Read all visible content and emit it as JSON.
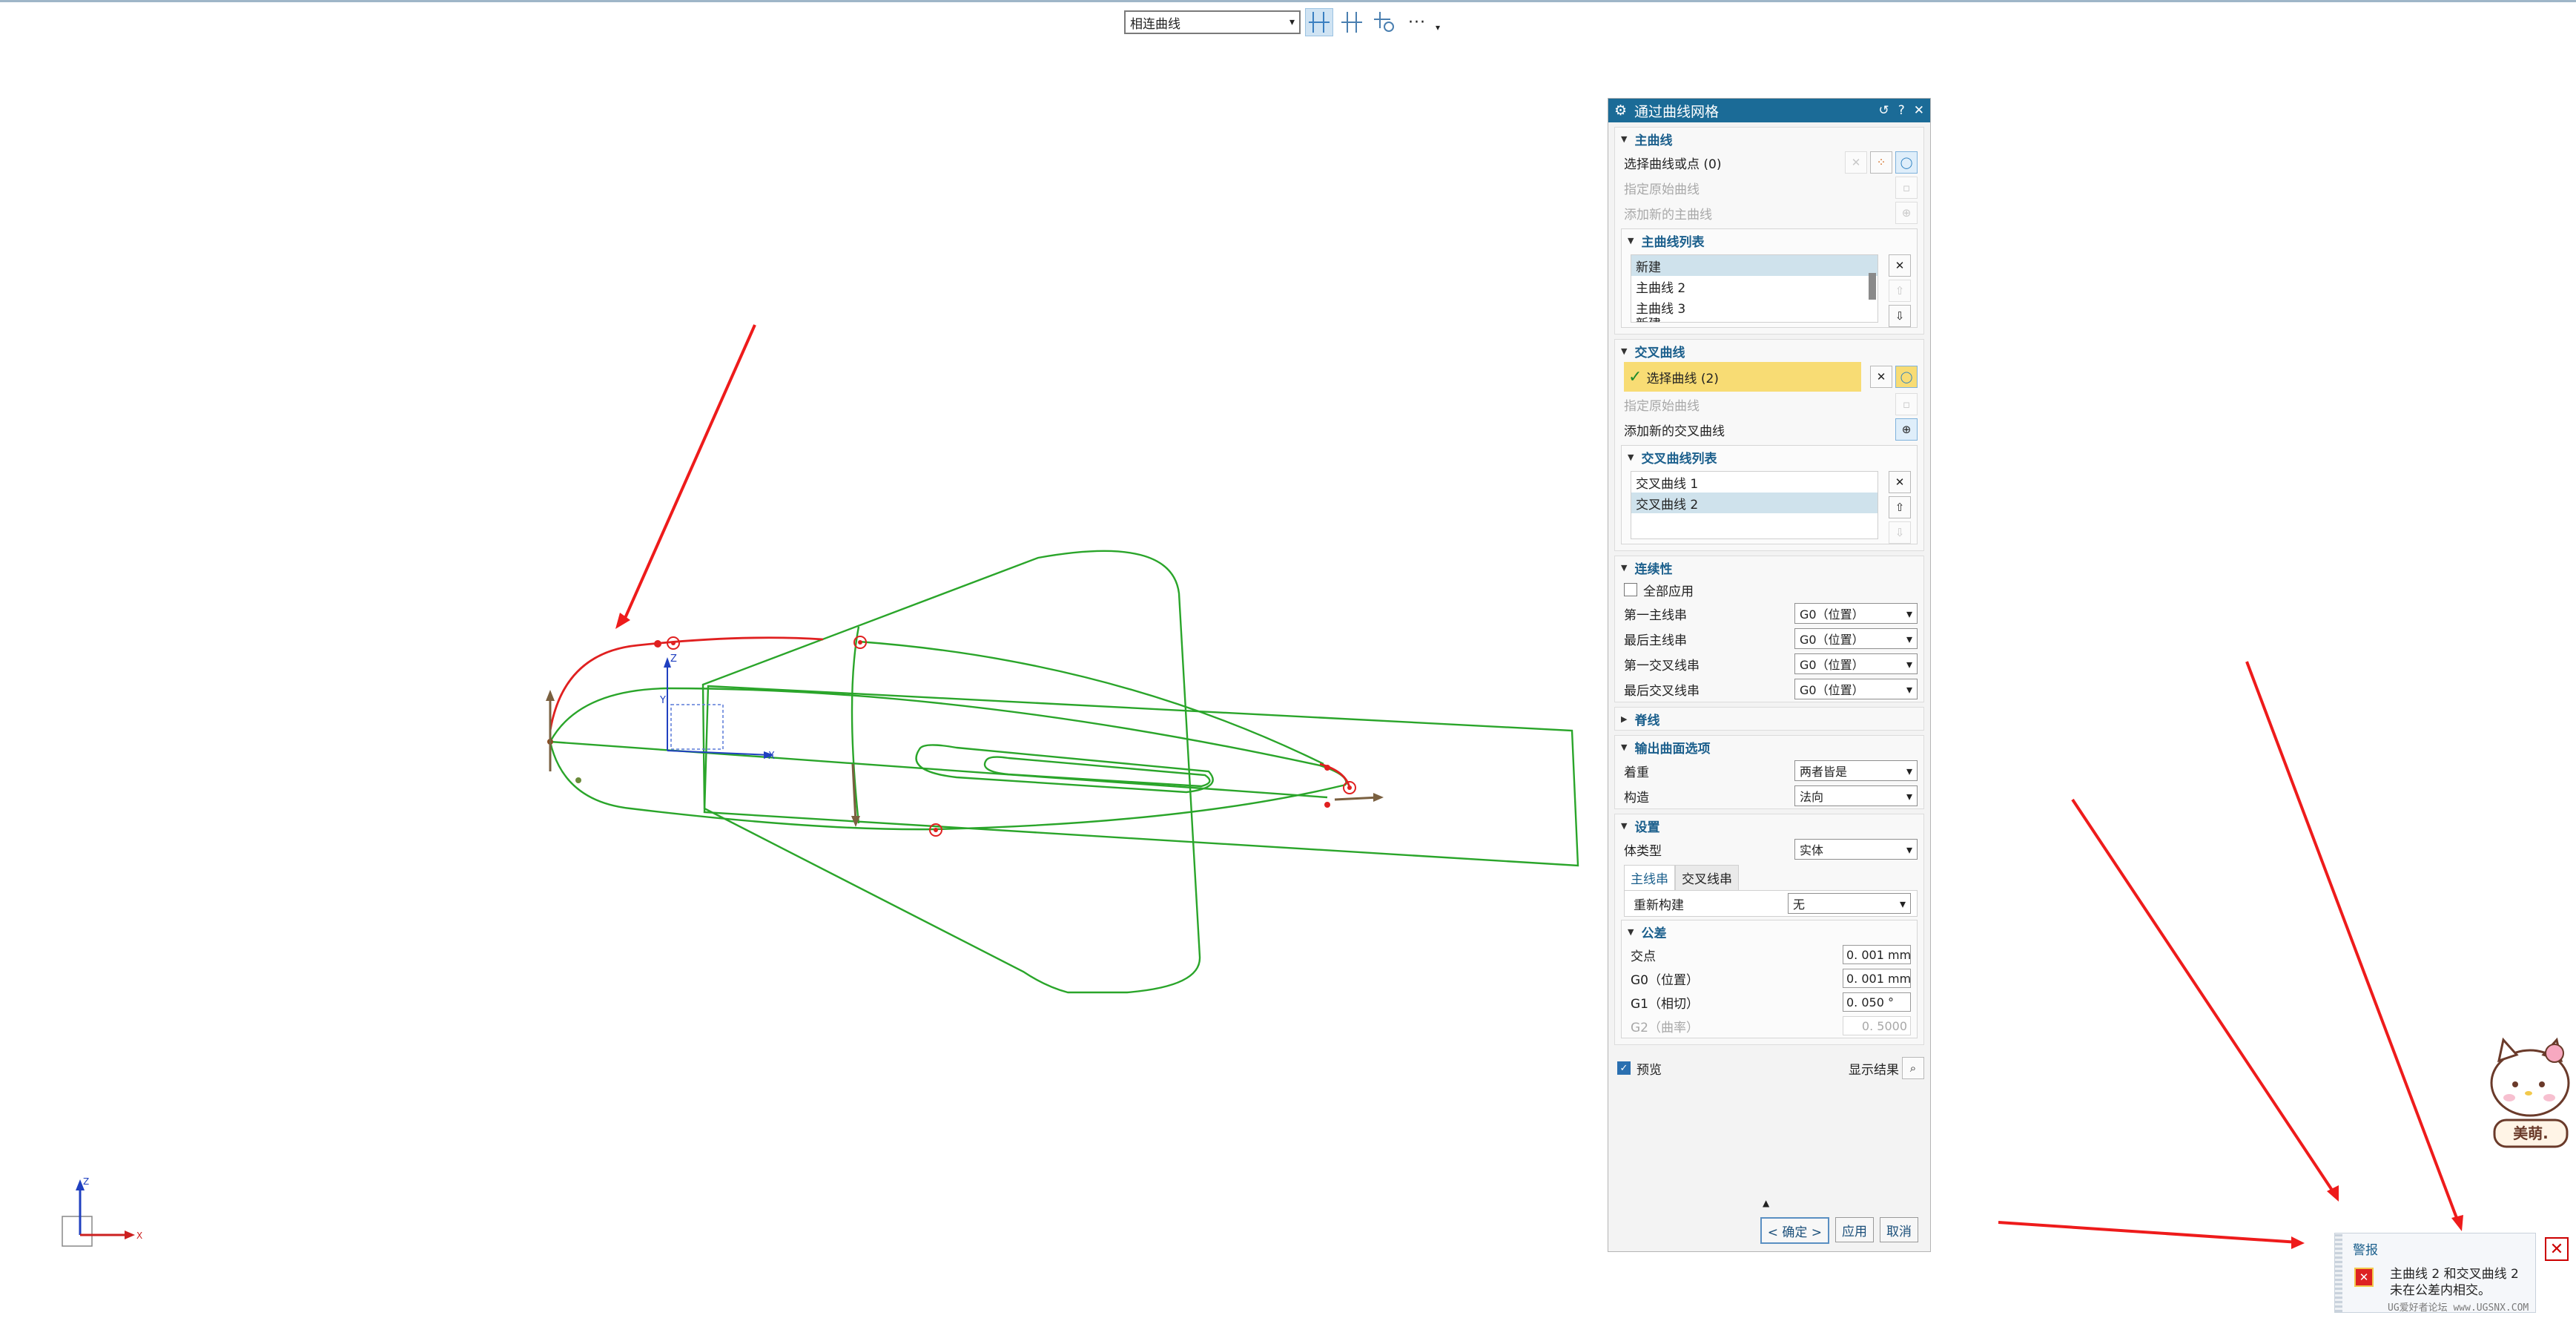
{
  "selection_toolbar": {
    "curve_rule": "相连曲线"
  },
  "dialog": {
    "title": "通过曲线网格",
    "primary": {
      "header": "主曲线",
      "select_label": "选择曲线或点 (0)",
      "specify_origin": "指定原始曲线",
      "add_new": "添加新的主曲线",
      "list_header": "主曲线列表",
      "list": [
        "新建",
        "主曲线 2",
        "主曲线 3",
        "新建"
      ]
    },
    "cross": {
      "header": "交叉曲线",
      "select_label": "选择曲线 (2)",
      "specify_origin": "指定原始曲线",
      "add_new": "添加新的交叉曲线",
      "list_header": "交叉曲线列表",
      "list": [
        "交叉曲线 1",
        "交叉曲线 2"
      ]
    },
    "continuity": {
      "header": "连续性",
      "apply_all": "全部应用",
      "rows": [
        {
          "label": "第一主线串",
          "value": "G0（位置）"
        },
        {
          "label": "最后主线串",
          "value": "G0（位置）"
        },
        {
          "label": "第一交叉线串",
          "value": "G0（位置）"
        },
        {
          "label": "最后交叉线串",
          "value": "G0（位置）"
        }
      ]
    },
    "spine": {
      "header": "脊线"
    },
    "output": {
      "header": "输出曲面选项",
      "emphasis_label": "着重",
      "emphasis_value": "两者皆是",
      "construction_label": "构造",
      "construction_value": "法向"
    },
    "settings": {
      "header": "设置",
      "body_type_label": "体类型",
      "body_type_value": "实体",
      "tab_primary": "主线串",
      "tab_cross": "交叉线串",
      "rebuild_label": "重新构建",
      "rebuild_value": "无",
      "tolerance": {
        "header": "公差",
        "rows": [
          {
            "label": "交点",
            "value": "0. 001 mm"
          },
          {
            "label": "G0（位置）",
            "value": "0. 001 mm"
          },
          {
            "label": "G1（相切）",
            "value": "0. 050 °"
          },
          {
            "label": "G2（曲率）",
            "value": "0. 5000"
          }
        ]
      }
    },
    "preview": {
      "label": "预览",
      "show_result": "显示结果"
    },
    "buttons": {
      "ok": "< 确定 >",
      "apply": "应用",
      "cancel": "取消"
    }
  },
  "alert": {
    "title": "警报",
    "message_line1": "主曲线 2 和交叉曲线 2",
    "message_line2": "未在公差内相交。"
  },
  "mascot": {
    "label": "美萌."
  },
  "watermark": "UG爱好者论坛 www.UGSNX.COM",
  "triad": {
    "z": "Z",
    "x": "X",
    "y": "Y"
  },
  "colors": {
    "title_bar": "#1b6b97",
    "curve_green": "#2aa52a",
    "curve_red": "#e02020",
    "arrow_red": "#ee1b1b",
    "selection_highlight": "#f8dc74"
  }
}
